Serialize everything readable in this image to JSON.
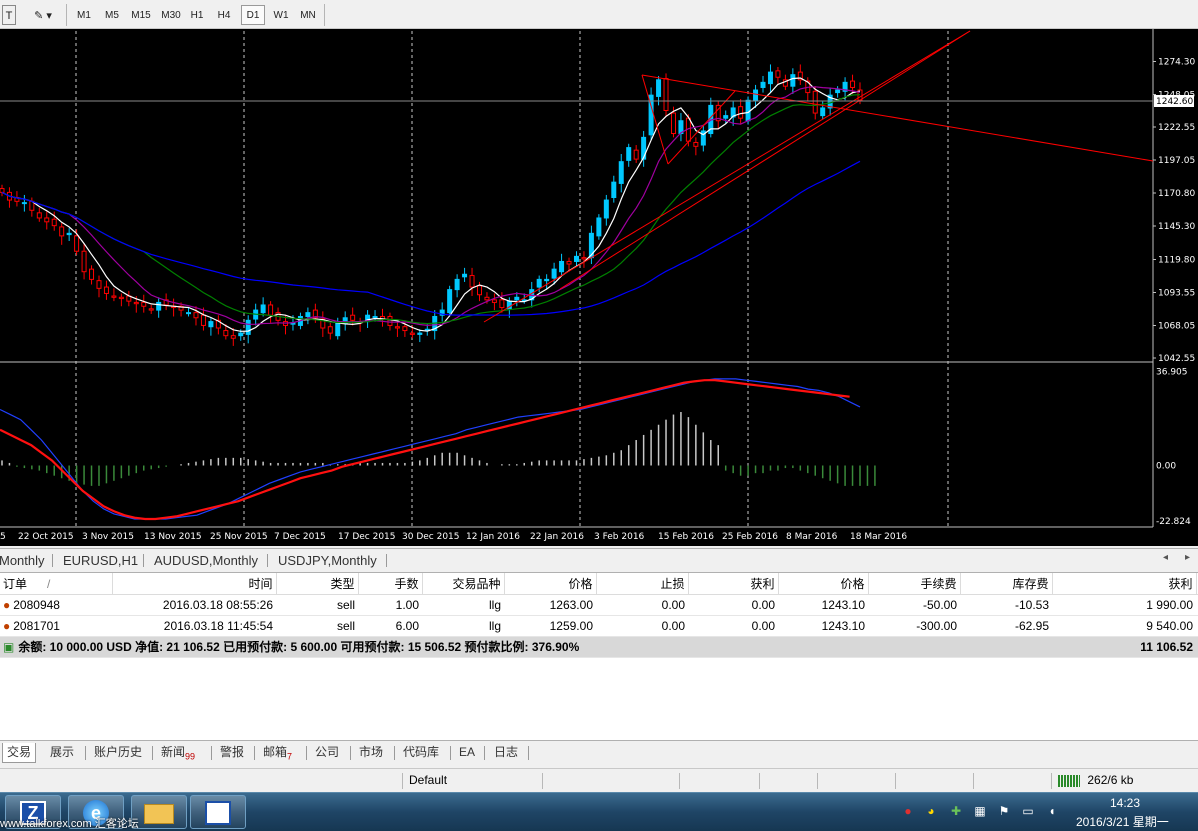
{
  "toolbar": {
    "timeframes": [
      "M1",
      "M5",
      "M15",
      "M30",
      "H1",
      "H4",
      "D1",
      "W1",
      "MN"
    ],
    "active_timeframe": "D1"
  },
  "chart_data": [
    {
      "type": "candlestick",
      "title": "",
      "y_ticks": [
        "1274.30",
        "1248.05",
        "1222.55",
        "1197.05",
        "1170.80",
        "1145.30",
        "1119.80",
        "1093.55",
        "1068.05",
        "1042.55"
      ],
      "current_price": "1242.60",
      "ylim": [
        1042.55,
        1285
      ],
      "x_ticks": [
        "5",
        "22 Oct 2015",
        "3 Nov 2015",
        "13 Nov 2015",
        "25 Nov 2015",
        "7 Dec 2015",
        "17 Dec 2015",
        "30 Dec 2015",
        "12 Jan 2016",
        "22 Jan 2016",
        "3 Feb 2016",
        "15 Feb 2016",
        "25 Feb 2016",
        "8 Mar 2016",
        "18 Mar 2016"
      ],
      "close": [
        1172,
        1166,
        1165,
        1164,
        1158,
        1152,
        1149,
        1146,
        1138,
        1140,
        1126,
        1110,
        1104,
        1097,
        1093,
        1090,
        1089,
        1087,
        1085,
        1083,
        1080,
        1086,
        1084,
        1082,
        1080,
        1078,
        1074,
        1068,
        1071,
        1066,
        1060,
        1058,
        1062,
        1072,
        1080,
        1084,
        1076,
        1072,
        1068,
        1070,
        1075,
        1078,
        1074,
        1066,
        1062,
        1070,
        1074,
        1072,
        1070,
        1076,
        1075,
        1073,
        1068,
        1066,
        1064,
        1061,
        1062,
        1065,
        1075,
        1080,
        1096,
        1104,
        1108,
        1098,
        1092,
        1088,
        1086,
        1082,
        1087,
        1090,
        1088,
        1096,
        1104,
        1104,
        1112,
        1118,
        1116,
        1122,
        1120,
        1140,
        1152,
        1166,
        1180,
        1196,
        1207,
        1198,
        1215,
        1248,
        1260,
        1236,
        1218,
        1228,
        1212,
        1208,
        1220,
        1240,
        1228,
        1232,
        1238,
        1230,
        1244,
        1252,
        1258,
        1266,
        1262,
        1255,
        1264,
        1260,
        1250,
        1234,
        1238,
        1248,
        1252,
        1258,
        1254,
        1244
      ],
      "moving_averages": "4 lines (white, purple, green, blue) plus red trend lines",
      "grid": "vertical dashed lines"
    },
    {
      "type": "macd",
      "y_ticks": [
        "36.905",
        "0.00",
        "-22.824"
      ],
      "ylim": [
        -22.824,
        36.905
      ],
      "histogram": [
        2,
        1,
        -0.5,
        -1,
        -1.5,
        -2,
        -3,
        -4,
        -5,
        -6,
        -7,
        -7.5,
        -8,
        -8,
        -7,
        -6,
        -5,
        -4,
        -3,
        -2,
        -1.5,
        -1,
        -0.5,
        0,
        0.5,
        1,
        1.5,
        2,
        2.5,
        3,
        3,
        3,
        3,
        2.5,
        2,
        1.5,
        1,
        1,
        1,
        1,
        1,
        1,
        1,
        1,
        0.5,
        0.5,
        0.5,
        0.5,
        1,
        1,
        1,
        1,
        1,
        1,
        1,
        1.5,
        2,
        3,
        4,
        5,
        5,
        5,
        4,
        3,
        2,
        1,
        0,
        0.5,
        0.5,
        0.5,
        1,
        1.5,
        2,
        2,
        2,
        2,
        2,
        2,
        2.5,
        3,
        3.5,
        4,
        5,
        6,
        8,
        10,
        12,
        14,
        16,
        18,
        20,
        21,
        19,
        16,
        13,
        10,
        8,
        -2,
        -3,
        -4,
        -4,
        -3,
        -3,
        -2,
        -2,
        -1,
        -1,
        -2,
        -3,
        -4,
        -5,
        -6,
        -7,
        -8,
        -8,
        -8,
        -8,
        -8
      ],
      "macd_line": [
        22,
        20,
        18,
        14,
        10,
        5,
        0,
        -5,
        -10,
        -14,
        -17,
        -19,
        -20,
        -21,
        -21,
        -21,
        -21,
        -20.5,
        -20,
        -19.5,
        -18,
        -16.5,
        -15,
        -13,
        -11,
        -9,
        -7,
        -5.5,
        -4,
        -2.5,
        -1.5,
        -0.5,
        0.5,
        1.5,
        2.5,
        3.5,
        4.5,
        5.5,
        6.5,
        7.5,
        8.5,
        9.5,
        10.5,
        11.5,
        12.5,
        14,
        15,
        16,
        17,
        18,
        19,
        19.5,
        20,
        20.5,
        21,
        21.5,
        22,
        23,
        24,
        25,
        26,
        27,
        28,
        29,
        30,
        31,
        32,
        33,
        33.5,
        34,
        34,
        34,
        33.5,
        33,
        32.5,
        32,
        31.5,
        31,
        30,
        29.5,
        28.5,
        27,
        25,
        23
      ],
      "signal_line": [
        14,
        12,
        10,
        8,
        5,
        2,
        -2,
        -6,
        -10,
        -13,
        -16,
        -18,
        -19.5,
        -20.5,
        -21,
        -21,
        -20.5,
        -20,
        -19,
        -18,
        -17,
        -16,
        -15,
        -14,
        -12.5,
        -11,
        -9.5,
        -8,
        -6.5,
        -5,
        -4,
        -3,
        -2,
        -0.5,
        0.5,
        1.5,
        2.5,
        3.5,
        4.5,
        5.5,
        6.5,
        7.5,
        8.5,
        9.5,
        10.5,
        11.5,
        12.5,
        13.5,
        14.5,
        15.5,
        16.5,
        17.5,
        18.5,
        19.5,
        20.5,
        21.5,
        22.5,
        23.5,
        24.5,
        25.5,
        26.5,
        27.5,
        28.5,
        29.5,
        30.5,
        31.5,
        32.5,
        33,
        33.5,
        33.5,
        33,
        32.5,
        32,
        31.5,
        31,
        30.5,
        30,
        29.5,
        29,
        28.5,
        28,
        27.5,
        27
      ]
    }
  ],
  "symbol_tabs": [
    "Monthly",
    "EURUSD,H1",
    "AUDUSD,Monthly",
    "USDJPY,Monthly"
  ],
  "trade": {
    "headers": [
      "订单",
      "时间",
      "类型",
      "手数",
      "交易品种",
      "价格",
      "止损",
      "获利",
      "价格",
      "手续费",
      "库存费",
      "获利"
    ],
    "sort_mark": "/",
    "rows": [
      {
        "order": "2080948",
        "time": "2016.03.18 08:55:26",
        "type": "sell",
        "lots": "1.00",
        "symbol": "llg",
        "price": "1263.00",
        "sl": "0.00",
        "tp": "0.00",
        "cur": "1243.10",
        "commission": "-50.00",
        "swap": "-10.53",
        "profit": "1 990.00"
      },
      {
        "order": "2081701",
        "time": "2016.03.18 11:45:54",
        "type": "sell",
        "lots": "6.00",
        "symbol": "llg",
        "price": "1259.00",
        "sl": "0.00",
        "tp": "0.00",
        "cur": "1243.10",
        "commission": "-300.00",
        "swap": "-62.95",
        "profit": "9 540.00"
      }
    ],
    "close_symbol": "×",
    "balance_line": "余额: 10 000.00 USD  净值: 21 106.52  已用预付款: 5 600.00  可用预付款: 15 506.52  预付款比例: 376.90%",
    "total_profit": "11 106.52"
  },
  "bottom_tabs": [
    {
      "label": "交易",
      "badge": ""
    },
    {
      "label": "展示",
      "badge": ""
    },
    {
      "label": "账户历史",
      "badge": ""
    },
    {
      "label": "新闻",
      "badge": "99"
    },
    {
      "label": "警报",
      "badge": ""
    },
    {
      "label": "邮箱",
      "badge": "7"
    },
    {
      "label": "公司",
      "badge": ""
    },
    {
      "label": "市场",
      "badge": ""
    },
    {
      "label": "代码库",
      "badge": ""
    },
    {
      "label": "EA",
      "badge": ""
    },
    {
      "label": "日志",
      "badge": ""
    }
  ],
  "status": {
    "profile": "Default",
    "traffic": "262/6 kb"
  },
  "taskbar": {
    "watermark": "www.talkforex.com 汇客论坛",
    "time": "14:23",
    "date": "2016/3/21 星期一"
  },
  "colors": {
    "bull": "#00c8ff",
    "bear": "#ff0000",
    "ma_fast": "#ffffff",
    "ma_mid": "#a000a0",
    "ma_slow": "#008000",
    "ma_long": "#0000ff",
    "trend": "#ff0000"
  }
}
